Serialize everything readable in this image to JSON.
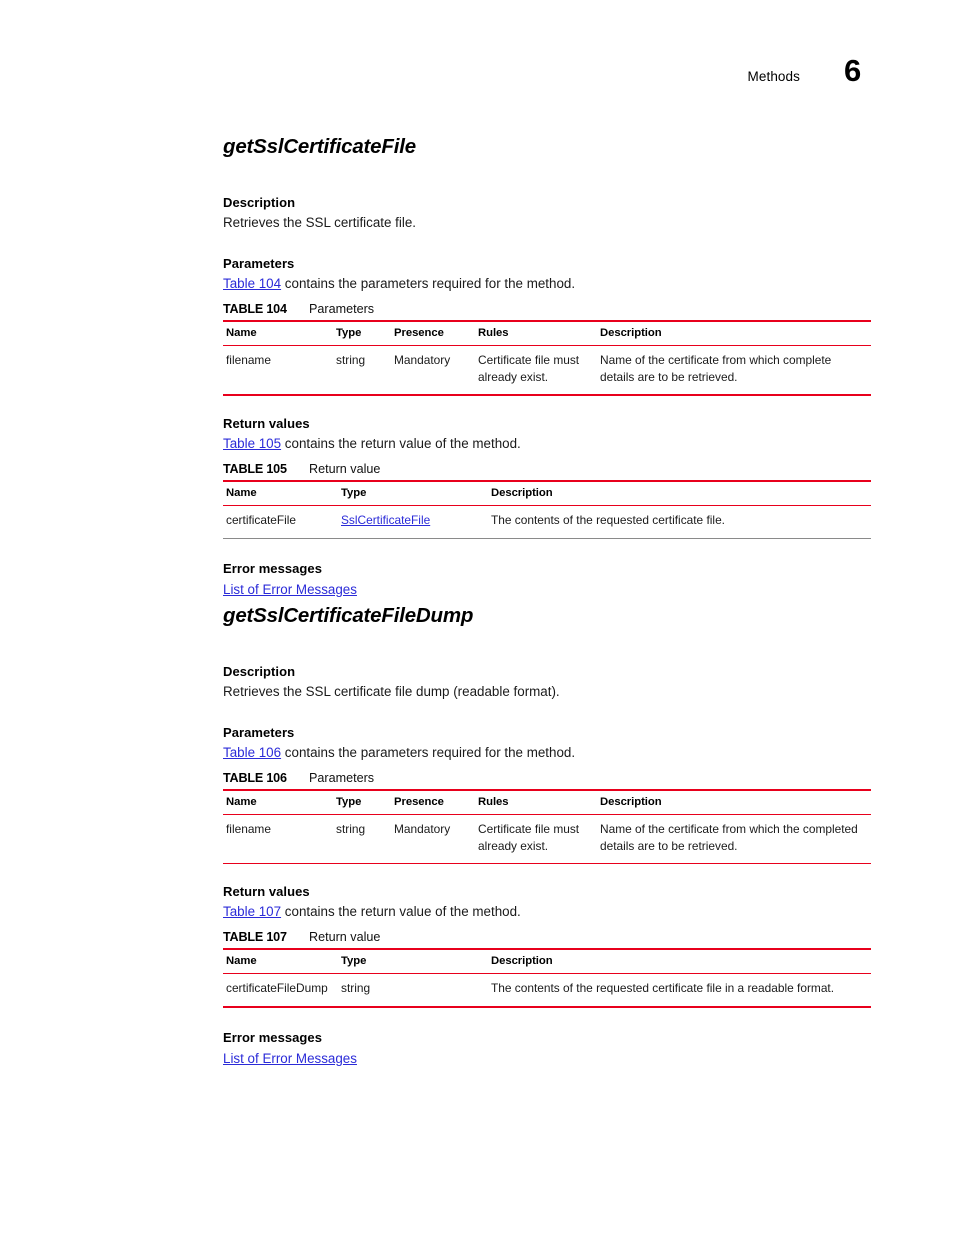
{
  "header": {
    "label": "Methods",
    "chapter": "6"
  },
  "sections": [
    {
      "title": "getSslCertificateFile",
      "description_head": "Description",
      "description_text": "Retrieves the SSL certificate file.",
      "parameters_head": "Parameters",
      "parameters_link": "Table 104",
      "parameters_intro_rest": " contains the parameters required for the method.",
      "param_table": {
        "caption_num": "TABLE 104",
        "caption_name": "Parameters",
        "headers": [
          "Name",
          "Type",
          "Presence",
          "Rules",
          "Description"
        ],
        "rows": [
          {
            "name": "filename",
            "type": "string",
            "presence": "Mandatory",
            "rules": "Certificate file must already exist.",
            "description": "Name of the certificate from which complete details are to be retrieved."
          }
        ]
      },
      "return_head": "Return values",
      "return_link": "Table 105",
      "return_intro_rest": " contains the return value of the method.",
      "return_table": {
        "caption_num": "TABLE 105",
        "caption_name": "Return value",
        "headers": [
          "Name",
          "Type",
          "Description"
        ],
        "rows": [
          {
            "name": "certificateFile",
            "type": "SslCertificateFile",
            "type_is_link": true,
            "description": "The contents of the requested certificate file."
          }
        ]
      },
      "error_head": "Error messages",
      "error_link": "List of Error Messages"
    },
    {
      "title": "getSslCertificateFileDump",
      "description_head": "Description",
      "description_text": "Retrieves the SSL certificate file dump (readable format).",
      "parameters_head": "Parameters",
      "parameters_link": "Table 106",
      "parameters_intro_rest": " contains the parameters required for the method.",
      "param_table": {
        "caption_num": "TABLE 106",
        "caption_name": "Parameters",
        "headers": [
          "Name",
          "Type",
          "Presence",
          "Rules",
          "Description"
        ],
        "rows": [
          {
            "name": "filename",
            "type": "string",
            "presence": "Mandatory",
            "rules": "Certificate file must already exist.",
            "description": "Name of the certificate from which the completed details are to be retrieved."
          }
        ]
      },
      "return_head": "Return values",
      "return_link": "Table 107",
      "return_intro_rest": " contains the return value of the method.",
      "return_table": {
        "caption_num": "TABLE 107",
        "caption_name": "Return value",
        "headers": [
          "Name",
          "Type",
          "Description"
        ],
        "rows": [
          {
            "name": "certificateFileDump",
            "type": "string",
            "type_is_link": false,
            "description": "The contents of the requested certificate file in a readable format."
          }
        ]
      },
      "error_head": "Error messages",
      "error_link": "List of Error Messages"
    }
  ],
  "colors": {
    "rule_red": "#E8001C",
    "link_blue": "#2B2BD8",
    "text_black": "#000000"
  }
}
